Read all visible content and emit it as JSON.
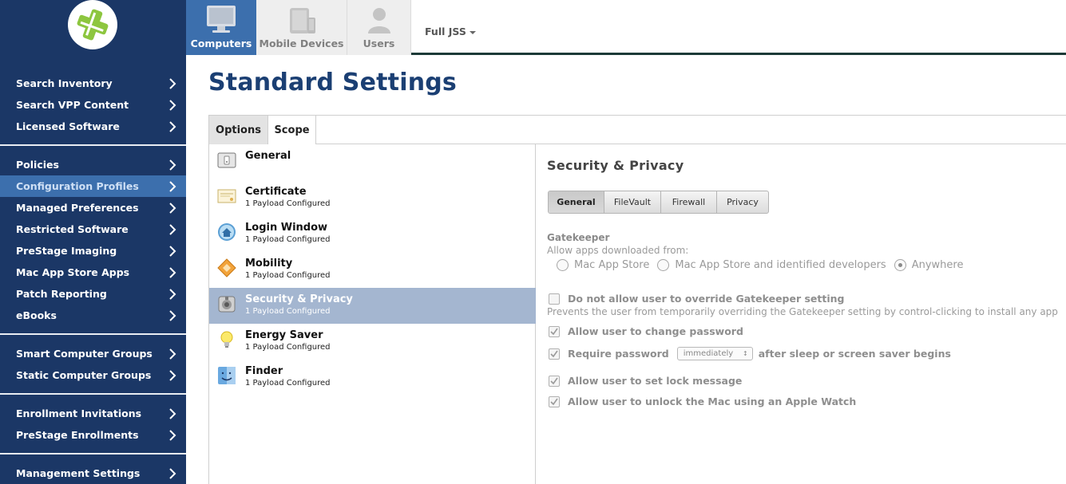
{
  "sidebar": {
    "groups": [
      [
        "Search Inventory",
        "Search VPP Content",
        "Licensed Software"
      ],
      [
        "Policies",
        "Configuration Profiles",
        "Managed Preferences",
        "Restricted Software",
        "PreStage Imaging",
        "Mac App Store Apps",
        "Patch Reporting",
        "eBooks"
      ],
      [
        "Smart Computer Groups",
        "Static Computer Groups"
      ],
      [
        "Enrollment Invitations",
        "PreStage Enrollments"
      ],
      [
        "Management Settings"
      ]
    ],
    "active": "Configuration Profiles"
  },
  "topbar": {
    "tabs": [
      {
        "label": "Computers",
        "icon": "computer-icon"
      },
      {
        "label": "Mobile Devices",
        "icon": "mobile-devices-icon"
      },
      {
        "label": "Users",
        "icon": "user-icon"
      }
    ],
    "site": "Full JSS"
  },
  "page": {
    "title": "Standard Settings",
    "tabs": [
      "Options",
      "Scope"
    ]
  },
  "payloads": [
    {
      "name": "General",
      "sub": "",
      "icon": "general-icon"
    },
    {
      "name": "Certificate",
      "sub": "1 Payload Configured",
      "icon": "certificate-icon"
    },
    {
      "name": "Login Window",
      "sub": "1 Payload Configured",
      "icon": "login-window-icon"
    },
    {
      "name": "Mobility",
      "sub": "1 Payload Configured",
      "icon": "mobility-icon"
    },
    {
      "name": "Security & Privacy",
      "sub": "1 Payload Configured",
      "icon": "security-icon"
    },
    {
      "name": "Energy Saver",
      "sub": "1 Payload Configured",
      "icon": "lightbulb-icon"
    },
    {
      "name": "Finder",
      "sub": "1 Payload Configured",
      "icon": "finder-icon"
    }
  ],
  "detail": {
    "title": "Security & Privacy",
    "segments": [
      "General",
      "FileVault",
      "Firewall",
      "Privacy"
    ],
    "gatekeeper_label": "Gatekeeper",
    "gatekeeper_sub": "Allow apps downloaded from:",
    "radio_options": [
      "Mac App Store",
      "Mac App Store and identified developers",
      "Anywhere"
    ],
    "radio_selected": "Anywhere",
    "override_label": "Do not allow user to override Gatekeeper setting",
    "override_note": "Prevents the user from temporarily overriding the Gatekeeper setting by control-clicking to install any app",
    "change_password": "Allow user to change password",
    "require_password": "Require password",
    "require_select": "immediately",
    "require_after": "after sleep or screen saver begins",
    "lock_message": "Allow user to set lock message",
    "apple_watch": "Allow user to unlock the Mac using an Apple Watch"
  },
  "colors": {
    "sidebar": "#1b3766",
    "accent": "#3c6fad",
    "title": "#1b3f73",
    "selected_row": "#a4b6d0"
  }
}
